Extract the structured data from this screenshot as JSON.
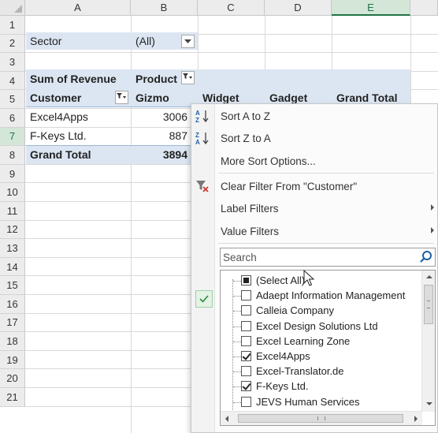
{
  "columns": [
    "A",
    "B",
    "C",
    "D",
    "E"
  ],
  "selected_column": "E",
  "rows": [
    "1",
    "2",
    "3",
    "4",
    "5",
    "6",
    "7",
    "8",
    "9",
    "10",
    "11",
    "12",
    "13",
    "14",
    "15",
    "16",
    "17",
    "18",
    "19",
    "20",
    "21"
  ],
  "selected_row": "7",
  "pivot": {
    "filter_label": "Sector",
    "filter_value": "(All)",
    "values_label": "Sum of Revenue",
    "columns_label": "Product",
    "row_field": "Customer",
    "col_items": [
      "Gizmo",
      "Widget",
      "Gadget",
      "Grand Total"
    ],
    "data_rows": [
      {
        "label": "Excel4Apps",
        "gizmo": "3006"
      },
      {
        "label": "F-Keys Ltd.",
        "gizmo": "887"
      }
    ],
    "grand_total_label": "Grand Total",
    "grand_total_gizmo": "3894"
  },
  "menu": {
    "sort_asc": "Sort A to Z",
    "sort_desc": "Sort Z to A",
    "more_sort": "More Sort Options...",
    "clear_filter": "Clear Filter From \"Customer\"",
    "label_filters": "Label Filters",
    "value_filters": "Value Filters",
    "search_placeholder": "Search",
    "items": [
      {
        "label": "(Select All)",
        "state": "partial"
      },
      {
        "label": "Adaept Information Management",
        "state": "unchecked"
      },
      {
        "label": "Calleia Company",
        "state": "unchecked"
      },
      {
        "label": "Excel Design Solutions Ltd",
        "state": "unchecked"
      },
      {
        "label": "Excel Learning Zone",
        "state": "unchecked"
      },
      {
        "label": "Excel4Apps",
        "state": "checked"
      },
      {
        "label": "Excel-Translator.de",
        "state": "unchecked"
      },
      {
        "label": "F-Keys Ltd.",
        "state": "checked"
      },
      {
        "label": "JEVS Human Services",
        "state": "unchecked"
      }
    ]
  },
  "colors": {
    "pivot_band": "#dce6f2",
    "selected_header": "#d3e6d7",
    "accent_green": "#217346"
  }
}
